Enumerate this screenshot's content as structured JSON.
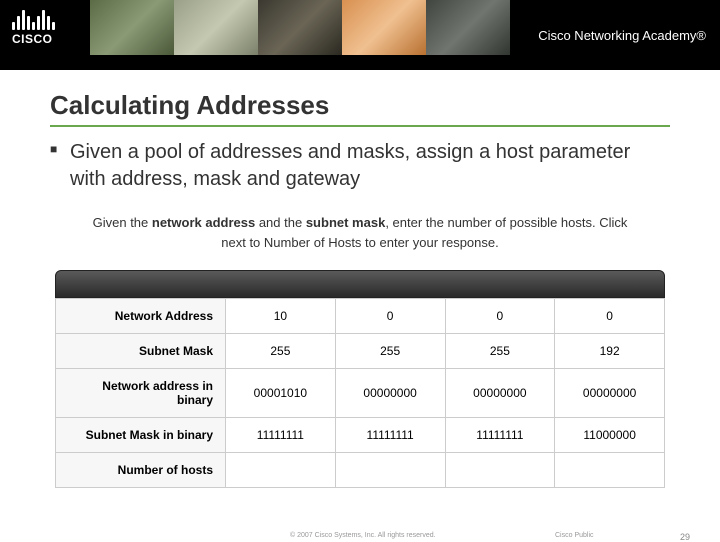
{
  "header": {
    "logo_text": "CISCO",
    "academy": "Cisco Networking Academy®"
  },
  "slide": {
    "title": "Calculating Addresses",
    "bullet": "Given a pool of addresses and masks, assign a host parameter with address, mask and gateway"
  },
  "activity": {
    "instruction_prefix": "Given the ",
    "b1": "network address",
    "mid1": " and the ",
    "b2": "subnet mask",
    "mid2": ", enter the number of possible hosts. Click next to Number of Hosts to enter your response.",
    "rows": [
      {
        "label": "Network Address",
        "c": [
          "10",
          "0",
          "0",
          "0"
        ]
      },
      {
        "label": "Subnet Mask",
        "c": [
          "255",
          "255",
          "255",
          "192"
        ]
      },
      {
        "label": "Network address in binary",
        "c": [
          "00001010",
          "00000000",
          "00000000",
          "00000000"
        ]
      },
      {
        "label": "Subnet Mask in binary",
        "c": [
          "11111111",
          "11111111",
          "11111111",
          "11000000"
        ]
      },
      {
        "label": "Number of hosts",
        "c": [
          "",
          "",
          "",
          ""
        ]
      }
    ]
  },
  "footer": {
    "copyright": "© 2007 Cisco Systems, Inc. All rights reserved.",
    "public": "Cisco Public",
    "page": "29"
  }
}
